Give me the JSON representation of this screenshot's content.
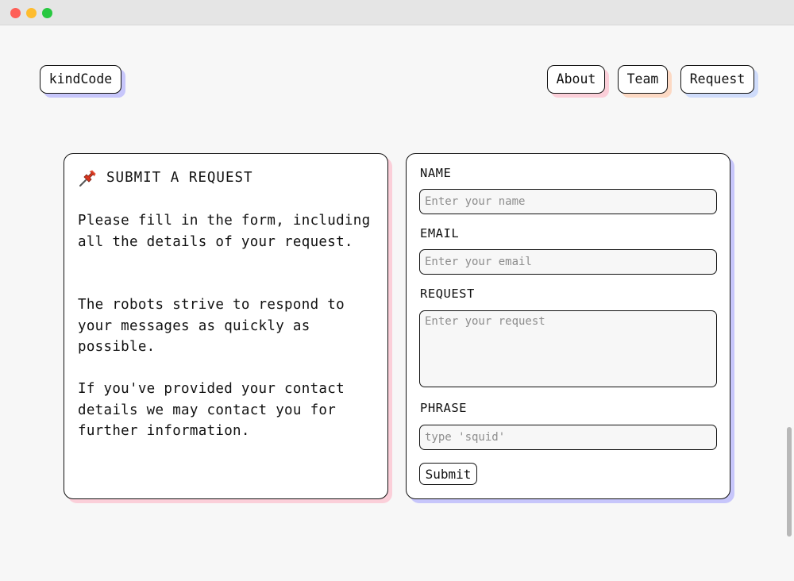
{
  "nav": {
    "logo": "kindCode",
    "links": [
      "About",
      "Team",
      "Request"
    ]
  },
  "info": {
    "title": "SUBMIT A REQUEST",
    "paragraphs": [
      "Please fill in the form, including all the details of your request.",
      "The robots strive to respond to your messages as quickly as possible.",
      "If you've provided your contact details we may contact you for further information."
    ]
  },
  "form": {
    "name_label": "NAME",
    "name_placeholder": "Enter your name",
    "email_label": "EMAIL",
    "email_placeholder": "Enter your email",
    "request_label": "REQUEST",
    "request_placeholder": "Enter your request",
    "phrase_label": "PHRASE",
    "phrase_placeholder": "type 'squid'",
    "submit_label": "Submit"
  },
  "colors": {
    "accent_blue": "#c7c6fb",
    "accent_pink": "#fbcfd9",
    "accent_peach": "#fcd9c4",
    "accent_lightblue": "#cfdcfb"
  },
  "icons": {
    "title_icon": "pushpin-icon"
  }
}
